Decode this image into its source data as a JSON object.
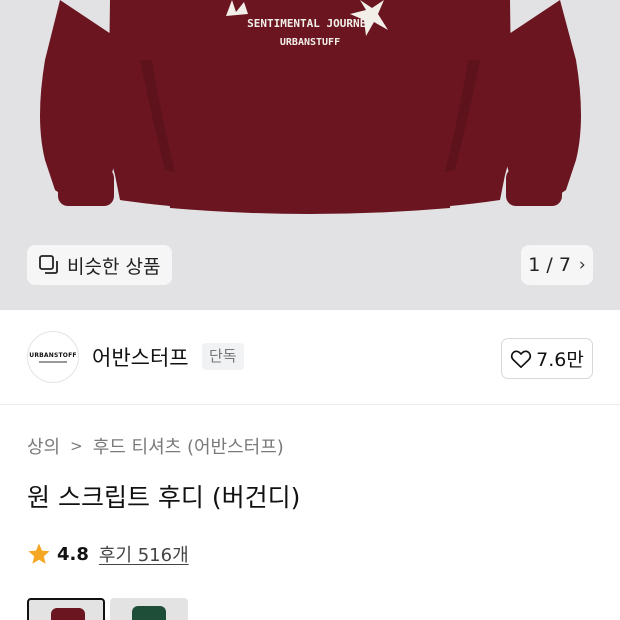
{
  "product_image": {
    "print_line_1": "SENTIMENTAL JOURNEY",
    "print_line_2": "URBANSTUFF",
    "garment_color": "#6b1520",
    "background_color": "#e2e2e4"
  },
  "similar_button": {
    "label": "비슷한 상품",
    "icon": "similar-products-icon"
  },
  "pager": {
    "current": "1",
    "separator": "/",
    "total": "7",
    "label": "1 / 7"
  },
  "brand": {
    "logo_text": "URBANSTOFF",
    "name": "어반스터프",
    "badge": "단독",
    "likes": "7.6만"
  },
  "breadcrumb": {
    "items": [
      "상의",
      "후드 티셔츠 (어반스터프)"
    ]
  },
  "product": {
    "title": "원 스크립트 후디 (버건디)",
    "rating": "4.8",
    "reviews_label": "후기 516개",
    "star_color": "#f5a623"
  },
  "color_options": [
    {
      "name": "burgundy",
      "swatch": "#6b1520",
      "selected": true
    },
    {
      "name": "green",
      "swatch": "#1e4d38",
      "selected": false
    }
  ]
}
